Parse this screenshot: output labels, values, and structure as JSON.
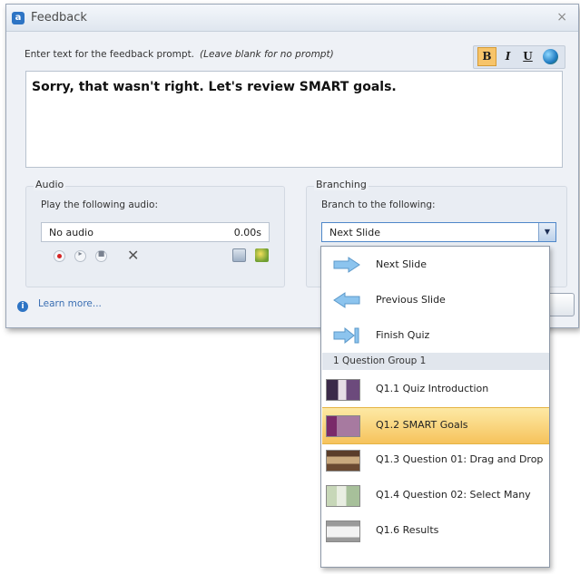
{
  "window": {
    "title": "Feedback",
    "close_label": "×",
    "app_icon_letter": "a"
  },
  "prompt": {
    "label": "Enter text for the feedback prompt.",
    "hint": "(Leave blank for no prompt)",
    "text": "Sorry, that wasn't right.  Let's review SMART goals."
  },
  "format_bar": {
    "bold": "B",
    "italic": "I",
    "underline": "U"
  },
  "audio": {
    "group_title": "Audio",
    "play_label": "Play the following audio:",
    "name": "No audio",
    "duration": "0.00s",
    "delete_label": "✕"
  },
  "branching": {
    "group_title": "Branching",
    "branch_label": "Branch to the following:",
    "selected_value": "Next Slide",
    "dropdown_arrow": "▼"
  },
  "footer": {
    "learn_more": "Learn more...",
    "info_icon": "i"
  },
  "dropdown": {
    "nav_items": [
      {
        "label": "Next Slide",
        "icon": "arrow-right-icon"
      },
      {
        "label": "Previous Slide",
        "icon": "arrow-left-icon"
      },
      {
        "label": "Finish Quiz",
        "icon": "arrow-end-icon"
      }
    ],
    "group_header": "1 Question Group 1",
    "slides": [
      {
        "label": "Q1.1 Quiz Introduction",
        "selected": false
      },
      {
        "label": "Q1.2 SMART Goals",
        "selected": true
      },
      {
        "label": "Q1.3 Question 01: Drag and Drop",
        "selected": false
      },
      {
        "label": "Q1.4 Question 02: Select Many",
        "selected": false
      },
      {
        "label": "Q1.6 Results",
        "selected": false
      }
    ]
  },
  "colors": {
    "accent": "#2d74c4",
    "selection": "#f6c35c",
    "arrow": "#7eb9e8"
  }
}
